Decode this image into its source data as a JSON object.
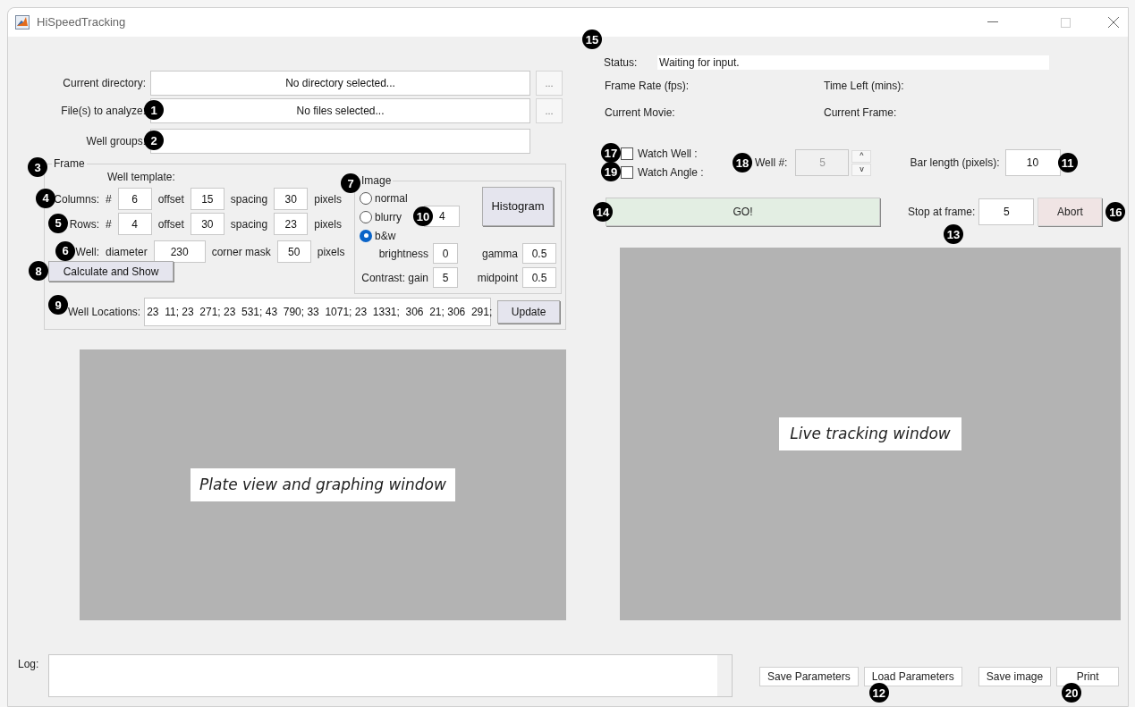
{
  "window": {
    "title": "HiSpeedTracking"
  },
  "file_fields": [
    {
      "label": "Current directory:",
      "value": "No directory selected...",
      "browse": "..."
    },
    {
      "label": "File(s) to analyze:",
      "value": "No files selected...",
      "browse": "...",
      "callout": "1"
    },
    {
      "label": "Well groups:",
      "callout": "2"
    }
  ],
  "frame": {
    "legend": "Frame",
    "callout": "3",
    "template_label": "Well template:",
    "rows": [
      {
        "label": "Columns:",
        "callout": "4",
        "items": [
          {
            "kind": "text",
            "text": "#"
          },
          {
            "kind": "field",
            "value": "6"
          },
          {
            "kind": "text",
            "text": "offset"
          },
          {
            "kind": "field",
            "value": "15"
          },
          {
            "kind": "text",
            "text": "spacing"
          },
          {
            "kind": "field",
            "value": "30"
          },
          {
            "kind": "text",
            "text": "pixels"
          }
        ]
      },
      {
        "label": "Rows:",
        "callout": "5",
        "items": [
          {
            "kind": "text",
            "text": "#"
          },
          {
            "kind": "field",
            "value": "4"
          },
          {
            "kind": "text",
            "text": "offset"
          },
          {
            "kind": "field",
            "value": "30"
          },
          {
            "kind": "text",
            "text": "spacing"
          },
          {
            "kind": "field",
            "value": "23"
          },
          {
            "kind": "text",
            "text": "pixels"
          }
        ]
      },
      {
        "label": "Well:",
        "callout": "6",
        "items": [
          {
            "kind": "text",
            "text": "diameter"
          },
          {
            "kind": "field",
            "value": "230"
          },
          {
            "kind": "text",
            "text": "corner mask"
          },
          {
            "kind": "field",
            "value": "50"
          },
          {
            "kind": "text",
            "text": "pixels"
          }
        ]
      }
    ],
    "calculate_button": {
      "label": "Calculate and Show",
      "callout": "8"
    },
    "image": {
      "legend": "Image",
      "callout": "7",
      "modes": [
        {
          "label": "normal",
          "selected": false
        },
        {
          "label": "blurry",
          "selected": false,
          "field": "4",
          "callout": "10"
        },
        {
          "label": "b&w",
          "selected": true
        }
      ],
      "histogram": "Histogram",
      "params": [
        {
          "label": "brightness",
          "value": "0"
        },
        {
          "label": "gamma",
          "value": "0.5"
        },
        {
          "label": "Contrast: gain",
          "value": "5"
        },
        {
          "label": "midpoint",
          "value": "0.5"
        }
      ]
    },
    "well_locations": {
      "label": "Well Locations:",
      "callout": "9",
      "value": "23  11; 23  271; 23  531; 43  790; 33  1071; 23  1331;  306  21; 306  291;",
      "button": "Update"
    }
  },
  "plate_view": {
    "caption": "Plate view and graphing window"
  },
  "status": {
    "label": "Status:",
    "value": "Waiting for input.",
    "callout": "15"
  },
  "readouts": [
    {
      "label": "Frame Rate (fps):"
    },
    {
      "label": "Time Left (mins):"
    },
    {
      "label": "Current Movie:"
    },
    {
      "label": "Current Frame:"
    }
  ],
  "watch": [
    {
      "label": "Watch Well :",
      "checked": false,
      "callout": "17"
    },
    {
      "label": "Watch Angle :",
      "checked": false,
      "callout": "19"
    }
  ],
  "well_number": {
    "label": "Well #:",
    "value": "5",
    "disabled": true,
    "callout": "18",
    "up": "^",
    "down": "v"
  },
  "bar_length": {
    "label": "Bar length (pixels):",
    "value": "10",
    "callout": "11"
  },
  "go_button": {
    "label": "GO!",
    "callout": "14"
  },
  "stop_at": {
    "label": "Stop at frame:",
    "value": "5",
    "callout": "13"
  },
  "abort_button": {
    "label": "Abort",
    "callout": "16"
  },
  "live_view": {
    "caption": "Live tracking window"
  },
  "log": {
    "label": "Log:"
  },
  "bottom_buttons": [
    {
      "label": "Save Parameters"
    },
    {
      "label": "Load Parameters",
      "callout": "12"
    },
    {
      "label": "Save image"
    },
    {
      "label": "Print",
      "callout": "20"
    }
  ]
}
